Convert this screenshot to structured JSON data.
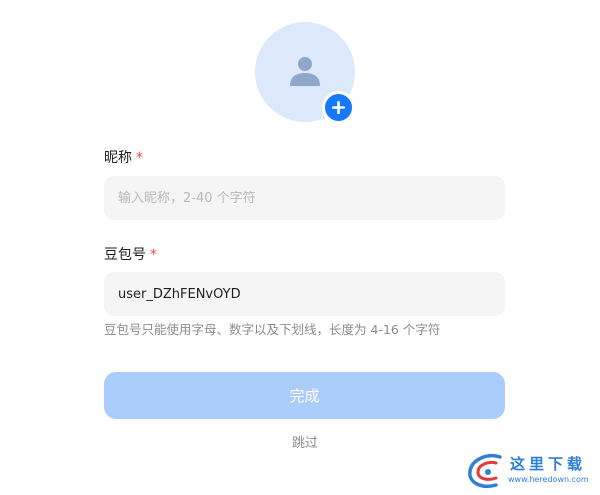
{
  "avatar": {
    "icon": "user-silhouette-icon",
    "add_icon": "plus-icon",
    "colors": {
      "bg": "#dbe9fb",
      "figure": "#8fa8c9",
      "add": "#1677ff"
    }
  },
  "nickname": {
    "label": "昵称",
    "required_mark": "*",
    "placeholder": "输入昵称，2-40 个字符",
    "value": ""
  },
  "doubao_id": {
    "label": "豆包号",
    "required_mark": "*",
    "value": "user_DZhFENvOYD",
    "hint": "豆包号只能使用字母、数字以及下划线，长度为 4-16 个字符"
  },
  "actions": {
    "submit_label": "完成",
    "skip_label": "跳过",
    "colors": {
      "submit_disabled": "#abcdfb"
    }
  },
  "watermark": {
    "text": "这里下载",
    "url": "www.heredown.com",
    "colors": {
      "blue": "#2e7fd6",
      "red": "#e23b3b"
    }
  }
}
